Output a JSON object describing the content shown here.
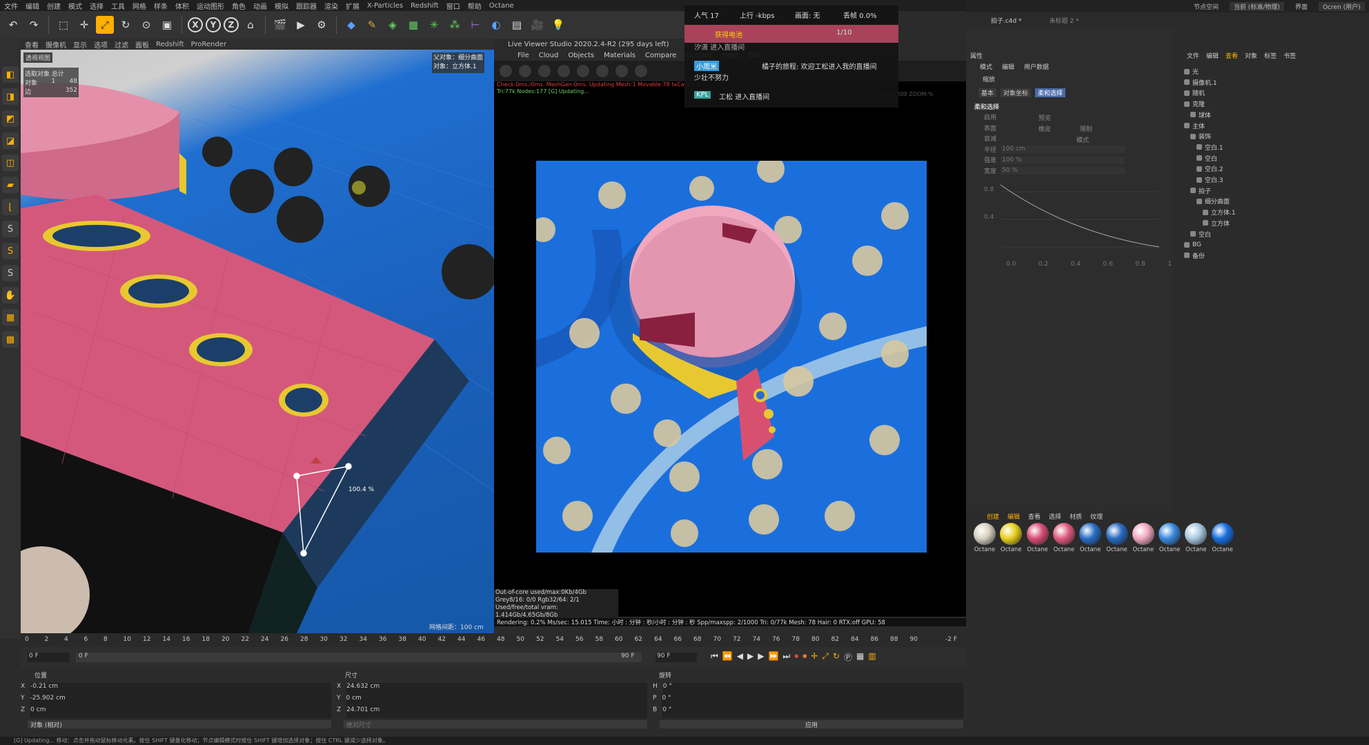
{
  "menu": [
    "文件",
    "编辑",
    "创建",
    "模式",
    "选择",
    "工具",
    "网格",
    "样条",
    "体积",
    "运动图形",
    "角色",
    "动画",
    "模拟",
    "跟踪器",
    "渲染",
    "扩展",
    "X-Particles",
    "Redshift",
    "窗口",
    "帮助",
    "Octane"
  ],
  "viewport": {
    "menu": [
      "查看",
      "摄像机",
      "显示",
      "选项",
      "过滤",
      "面板",
      "Redshift",
      "ProRender"
    ],
    "label": "透视视图",
    "stats_title": "选取对象  总计",
    "stats": [
      {
        "k": "对象",
        "v": "1",
        "t": "48"
      },
      {
        "k": "边",
        "v": "",
        "t": "352"
      }
    ],
    "obj_info": [
      "父对象：细分曲面",
      "对象：立方体.1"
    ],
    "grid_spacing": "网格间距：100 cm",
    "scale_label": "100.4 %"
  },
  "lvv": {
    "title": "Live Viewer Studio 2020.2.4-R2 (295 days left)",
    "menu": [
      "File",
      "Cloud",
      "Objects",
      "Materials",
      "Compare",
      "Options",
      "Help",
      "GUI"
    ],
    "status1": "Check:0ms./0ms. MeshGen:0ms. Updating Mesh:1 Movable:78 txCache:0",
    "status2": "Tri:77k Nodes:177  [G] Updating...",
    "rendering": "[RENDERING]",
    "zoom": "1200*1200 ZOOM:%",
    "info": [
      "Out-of-core used/max:0Kb/4Gb",
      "Grey8/16: 0/0          Rgb32/64: 2/1",
      "Used/free/total vram: 1.414Gb/4.65Gb/8Gb"
    ],
    "bottom": "Rendering: 0.2%   Ms/sec: 15.015   Time: 小时 : 分钟 : 秒/小时 : 分钟 : 秒   Spp/maxspp: 2/1000   Tri: 0/77k   Mesh: 78   Hair: 0   RTX:off   GPU: 58"
  },
  "stream": {
    "popularity": "人气 17",
    "upload": "上行 -kbps",
    "screen_label": "画面: 无",
    "drop": "丢帧 0.0%",
    "gift": "获得电池",
    "page": "1/10",
    "msg0": "汐潇 进入直播间",
    "msg1_user": "小周米",
    "msg1_text": "橘子的旅程: 欢迎工松进入我的直播间",
    "msg1_text2": "少壮不努力",
    "msg2_badge": "KPL",
    "msg2_text": "工松 进入直播间"
  },
  "timeline": {
    "ticks": [
      "0",
      "2",
      "4",
      "6",
      "8",
      "10",
      "12",
      "14",
      "16",
      "18",
      "20",
      "22",
      "24",
      "26",
      "28",
      "30",
      "32",
      "34",
      "36",
      "38",
      "40",
      "42",
      "44",
      "46",
      "48",
      "50",
      "52",
      "54",
      "56",
      "58",
      "60",
      "62",
      "64",
      "66",
      "68",
      "70",
      "72",
      "74",
      "76",
      "78",
      "80",
      "82",
      "84",
      "86",
      "88",
      "90"
    ],
    "end_label": "-2 F",
    "frame_start": "0 F",
    "frame_cur": "0 F",
    "frame_end": "90 F",
    "frame_end2": "90 F"
  },
  "coords": {
    "headers": [
      "位置",
      "尺寸",
      "旋转"
    ],
    "pos": [
      {
        "k": "X",
        "v": "-0.21 cm"
      },
      {
        "k": "Y",
        "v": "-25.902 cm"
      },
      {
        "k": "Z",
        "v": "0 cm"
      }
    ],
    "size": [
      {
        "k": "X",
        "v": "24.632 cm"
      },
      {
        "k": "Y",
        "v": "0 cm"
      },
      {
        "k": "Z",
        "v": "24.701 cm"
      }
    ],
    "rot": [
      {
        "k": "H",
        "v": "0 °"
      },
      {
        "k": "P",
        "v": "0 °"
      },
      {
        "k": "B",
        "v": "0 °"
      }
    ],
    "mode": "对象 (相对)",
    "size_mode": "绝对尺寸",
    "apply": "应用"
  },
  "statusbar": "[G] Updating...   移动：点击并拖动鼠标移动元素。按住 SHIFT 键量化移动；节点编辑模式时按住 SHIFT 键增加选择对象；按住 CTRL 键减少选择对象。",
  "attr": {
    "title": "属性",
    "tabs": [
      "模式",
      "编辑",
      "用户数据"
    ],
    "obj": "缩放",
    "subtabs": [
      "基本",
      "对象坐标",
      "柔和选择"
    ],
    "section": "柔和选择",
    "fields": [
      "启用",
      "预览",
      "表面",
      "橡皮",
      "限制",
      "衰减",
      "模式",
      "半径",
      "强度",
      "宽度"
    ],
    "radius": "100 cm",
    "strength": "100 %",
    "width": "50 %",
    "graph_y": [
      "0.8",
      "0.4"
    ],
    "graph_x": [
      "0.0",
      "0.2",
      "0.4",
      "0.6",
      "0.8",
      "1"
    ]
  },
  "doc": {
    "name": "拍子.c4d *",
    "name2": "未标题 2 *"
  },
  "objects": {
    "tabs": [
      "文件",
      "编辑",
      "查看",
      "对象",
      "标签",
      "书签"
    ],
    "items": [
      "光",
      "摄像机.1",
      "随机",
      "克隆",
      "球体",
      "主体",
      "装饰",
      "空白.1",
      "空白",
      "空白.2",
      "空白.3",
      "拍子",
      "细分曲面",
      "立方体.1",
      "立方体",
      "空白",
      "BG",
      "备份"
    ]
  },
  "materials": {
    "tabs": [
      "创建",
      "编辑",
      "查看",
      "选择",
      "材质",
      "纹理"
    ],
    "label": "Octane",
    "colors": [
      "#d8d0c0",
      "#e8d020",
      "#d85078",
      "#e05c80",
      "#2a70c8",
      "#2a6cc0",
      "#f0a8c0",
      "#3a8ae0",
      "#a8c8e0",
      "#1a70e0"
    ]
  },
  "header_right": [
    "节点空间",
    "当前 (标准/物理)",
    "界面",
    "Ocren (用户)"
  ]
}
